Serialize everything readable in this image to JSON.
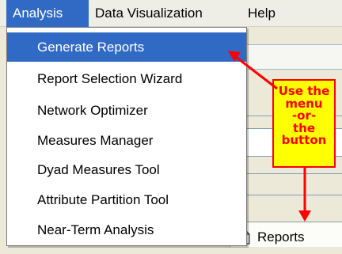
{
  "menubar": {
    "items": [
      {
        "label": "Analysis",
        "active": true
      },
      {
        "label": "Data Visualization",
        "active": false
      },
      {
        "label": "Help",
        "active": false
      }
    ]
  },
  "analysis_menu": {
    "items": [
      {
        "label": "Generate Reports",
        "selected": true
      },
      {
        "label": "Report Selection Wizard",
        "selected": false
      },
      {
        "label": "Network Optimizer",
        "selected": false
      },
      {
        "label": "Measures Manager",
        "selected": false
      },
      {
        "label": "Dyad Measures Tool",
        "selected": false
      },
      {
        "label": "Attribute Partition Tool",
        "selected": false
      },
      {
        "label": "Near-Term Analysis",
        "selected": false
      }
    ]
  },
  "tab": {
    "label": "Reports",
    "icon": "document-icon"
  },
  "callout": {
    "lines": [
      "Use the",
      "menu",
      "-or-",
      "the",
      "button"
    ],
    "fill_color": "#ffff00",
    "text_color": "#ff0000"
  },
  "colors": {
    "selection": "#316ac5",
    "arrow": "#ff0000"
  }
}
